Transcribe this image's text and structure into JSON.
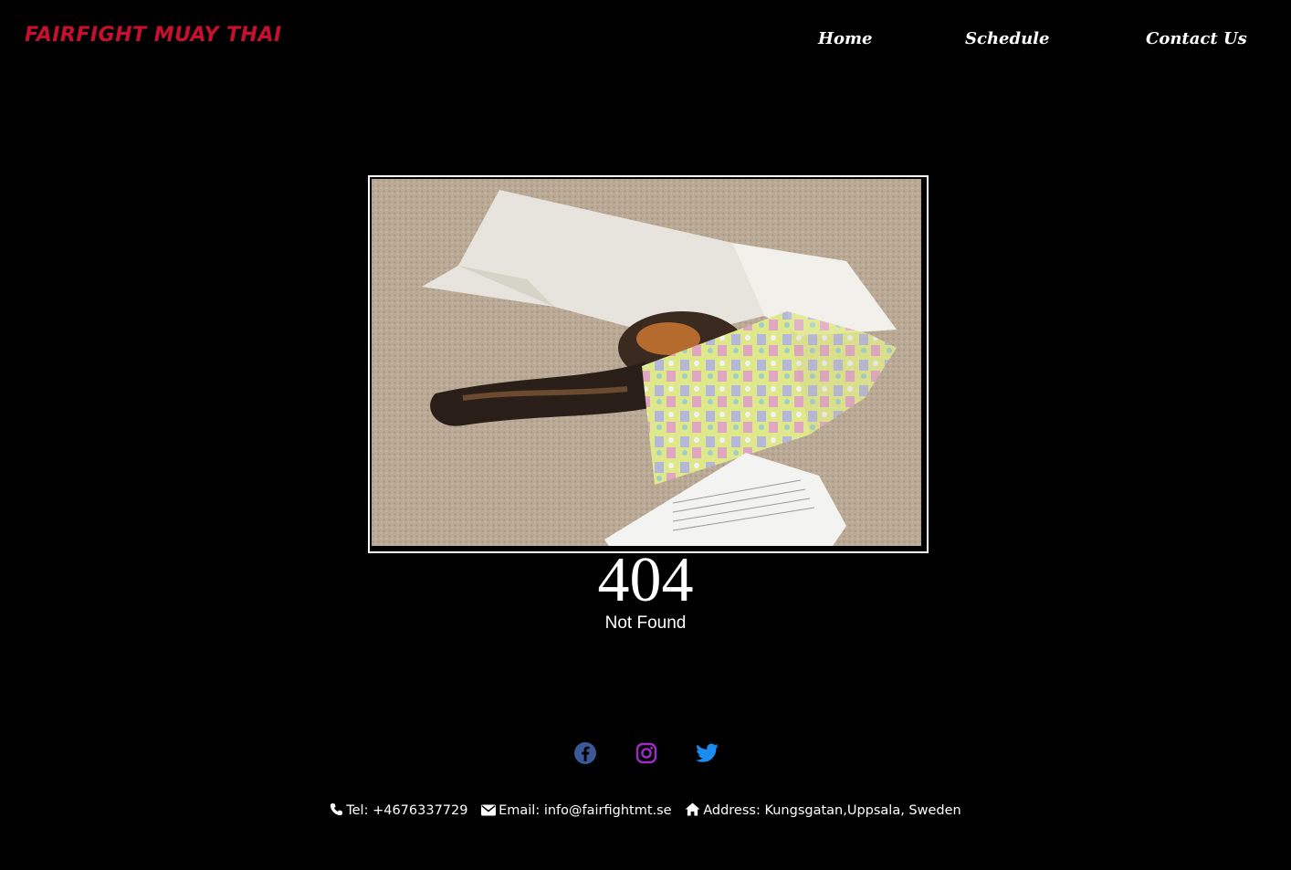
{
  "header": {
    "brand": "FAIRFIGHT MUAY THAI",
    "nav": [
      {
        "label": "Home"
      },
      {
        "label": "Schedule"
      },
      {
        "label": "Contact Us"
      }
    ]
  },
  "main": {
    "image_icon": "cat-in-box-photo",
    "error_code": "404",
    "error_message": "Not Found"
  },
  "footer": {
    "social": [
      {
        "icon": "facebook-icon",
        "color": "#3b5998"
      },
      {
        "icon": "instagram-icon",
        "color": "#9b2ec4"
      },
      {
        "icon": "twitter-icon",
        "color": "#1d8cf0"
      }
    ],
    "contact": {
      "tel": "Tel: +4676337729",
      "email": "Email: info@fairfightmt.se",
      "address": "Address: Kungsgatan,Uppsala, Sweden"
    }
  },
  "colors": {
    "background": "#000000",
    "brand": "#c8102e",
    "text": "#ffffff"
  }
}
